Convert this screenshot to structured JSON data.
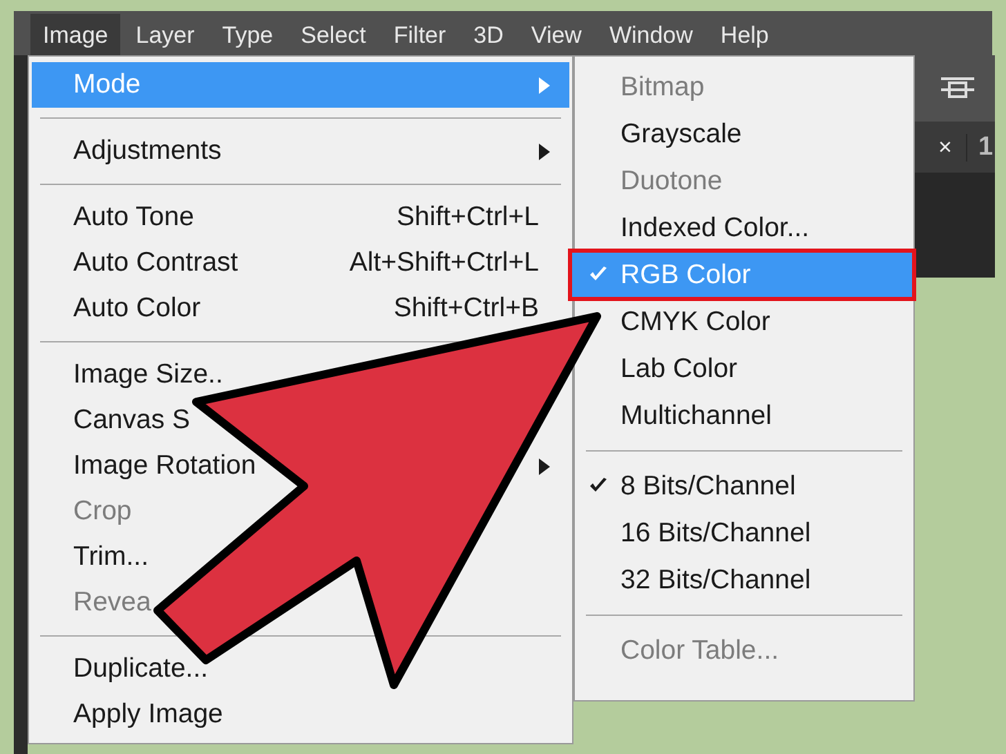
{
  "menubar": [
    {
      "label": "Image",
      "selected": true
    },
    {
      "label": "Layer",
      "selected": false
    },
    {
      "label": "Type",
      "selected": false
    },
    {
      "label": "Select",
      "selected": false
    },
    {
      "label": "Filter",
      "selected": false
    },
    {
      "label": "3D",
      "selected": false
    },
    {
      "label": "View",
      "selected": false
    },
    {
      "label": "Window",
      "selected": false
    },
    {
      "label": "Help",
      "selected": false
    }
  ],
  "image_menu": [
    {
      "kind": "item",
      "label": "Mode",
      "has_submenu": true,
      "selected": true,
      "disabled": false
    },
    {
      "kind": "separator"
    },
    {
      "kind": "item",
      "label": "Adjustments",
      "has_submenu": true,
      "selected": false,
      "disabled": false
    },
    {
      "kind": "separator"
    },
    {
      "kind": "item",
      "label": "Auto Tone",
      "shortcut": "Shift+Ctrl+L",
      "has_submenu": false,
      "selected": false,
      "disabled": false
    },
    {
      "kind": "item",
      "label": "Auto Contrast",
      "shortcut": "Alt+Shift+Ctrl+L",
      "has_submenu": false,
      "selected": false,
      "disabled": false
    },
    {
      "kind": "item",
      "label": "Auto Color",
      "shortcut": "Shift+Ctrl+B",
      "has_submenu": false,
      "selected": false,
      "disabled": false
    },
    {
      "kind": "separator"
    },
    {
      "kind": "item",
      "label": "Image Size..",
      "has_submenu": false,
      "selected": false,
      "disabled": false
    },
    {
      "kind": "item",
      "label": "Canvas S",
      "has_submenu": false,
      "selected": false,
      "disabled": false
    },
    {
      "kind": "item",
      "label": "Image Rotation",
      "has_submenu": true,
      "selected": false,
      "disabled": false
    },
    {
      "kind": "item",
      "label": "Crop",
      "has_submenu": false,
      "selected": false,
      "disabled": true
    },
    {
      "kind": "item",
      "label": "Trim...",
      "has_submenu": false,
      "selected": false,
      "disabled": false
    },
    {
      "kind": "item",
      "label": "Revea",
      "has_submenu": false,
      "selected": false,
      "disabled": true
    },
    {
      "kind": "separator"
    },
    {
      "kind": "item",
      "label": "Duplicate...",
      "has_submenu": false,
      "selected": false,
      "disabled": false
    },
    {
      "kind": "item",
      "label": "Apply Image",
      "has_submenu": false,
      "selected": false,
      "disabled": false
    }
  ],
  "mode_submenu": [
    {
      "kind": "item",
      "label": "Bitmap",
      "checked": false,
      "selected": false,
      "disabled": true,
      "outlined": false
    },
    {
      "kind": "item",
      "label": "Grayscale",
      "checked": false,
      "selected": false,
      "disabled": false,
      "outlined": false
    },
    {
      "kind": "item",
      "label": "Duotone",
      "checked": false,
      "selected": false,
      "disabled": true,
      "outlined": false
    },
    {
      "kind": "item",
      "label": "Indexed Color...",
      "checked": false,
      "selected": false,
      "disabled": false,
      "outlined": false
    },
    {
      "kind": "item",
      "label": "RGB Color",
      "checked": true,
      "selected": true,
      "disabled": false,
      "outlined": true
    },
    {
      "kind": "item",
      "label": "CMYK Color",
      "checked": false,
      "selected": false,
      "disabled": false,
      "outlined": false
    },
    {
      "kind": "item",
      "label": "Lab Color",
      "checked": false,
      "selected": false,
      "disabled": false,
      "outlined": false
    },
    {
      "kind": "item",
      "label": "Multichannel",
      "checked": false,
      "selected": false,
      "disabled": false,
      "outlined": false
    },
    {
      "kind": "separator"
    },
    {
      "kind": "item",
      "label": "8 Bits/Channel",
      "checked": true,
      "selected": false,
      "disabled": false,
      "outlined": false
    },
    {
      "kind": "item",
      "label": "16 Bits/Channel",
      "checked": false,
      "selected": false,
      "disabled": false,
      "outlined": false
    },
    {
      "kind": "item",
      "label": "32 Bits/Channel",
      "checked": false,
      "selected": false,
      "disabled": false,
      "outlined": false
    },
    {
      "kind": "separator"
    },
    {
      "kind": "item",
      "label": "Color Table...",
      "checked": false,
      "selected": false,
      "disabled": true,
      "outlined": false
    }
  ],
  "document_tab": {
    "close": "×",
    "label": "1"
  }
}
